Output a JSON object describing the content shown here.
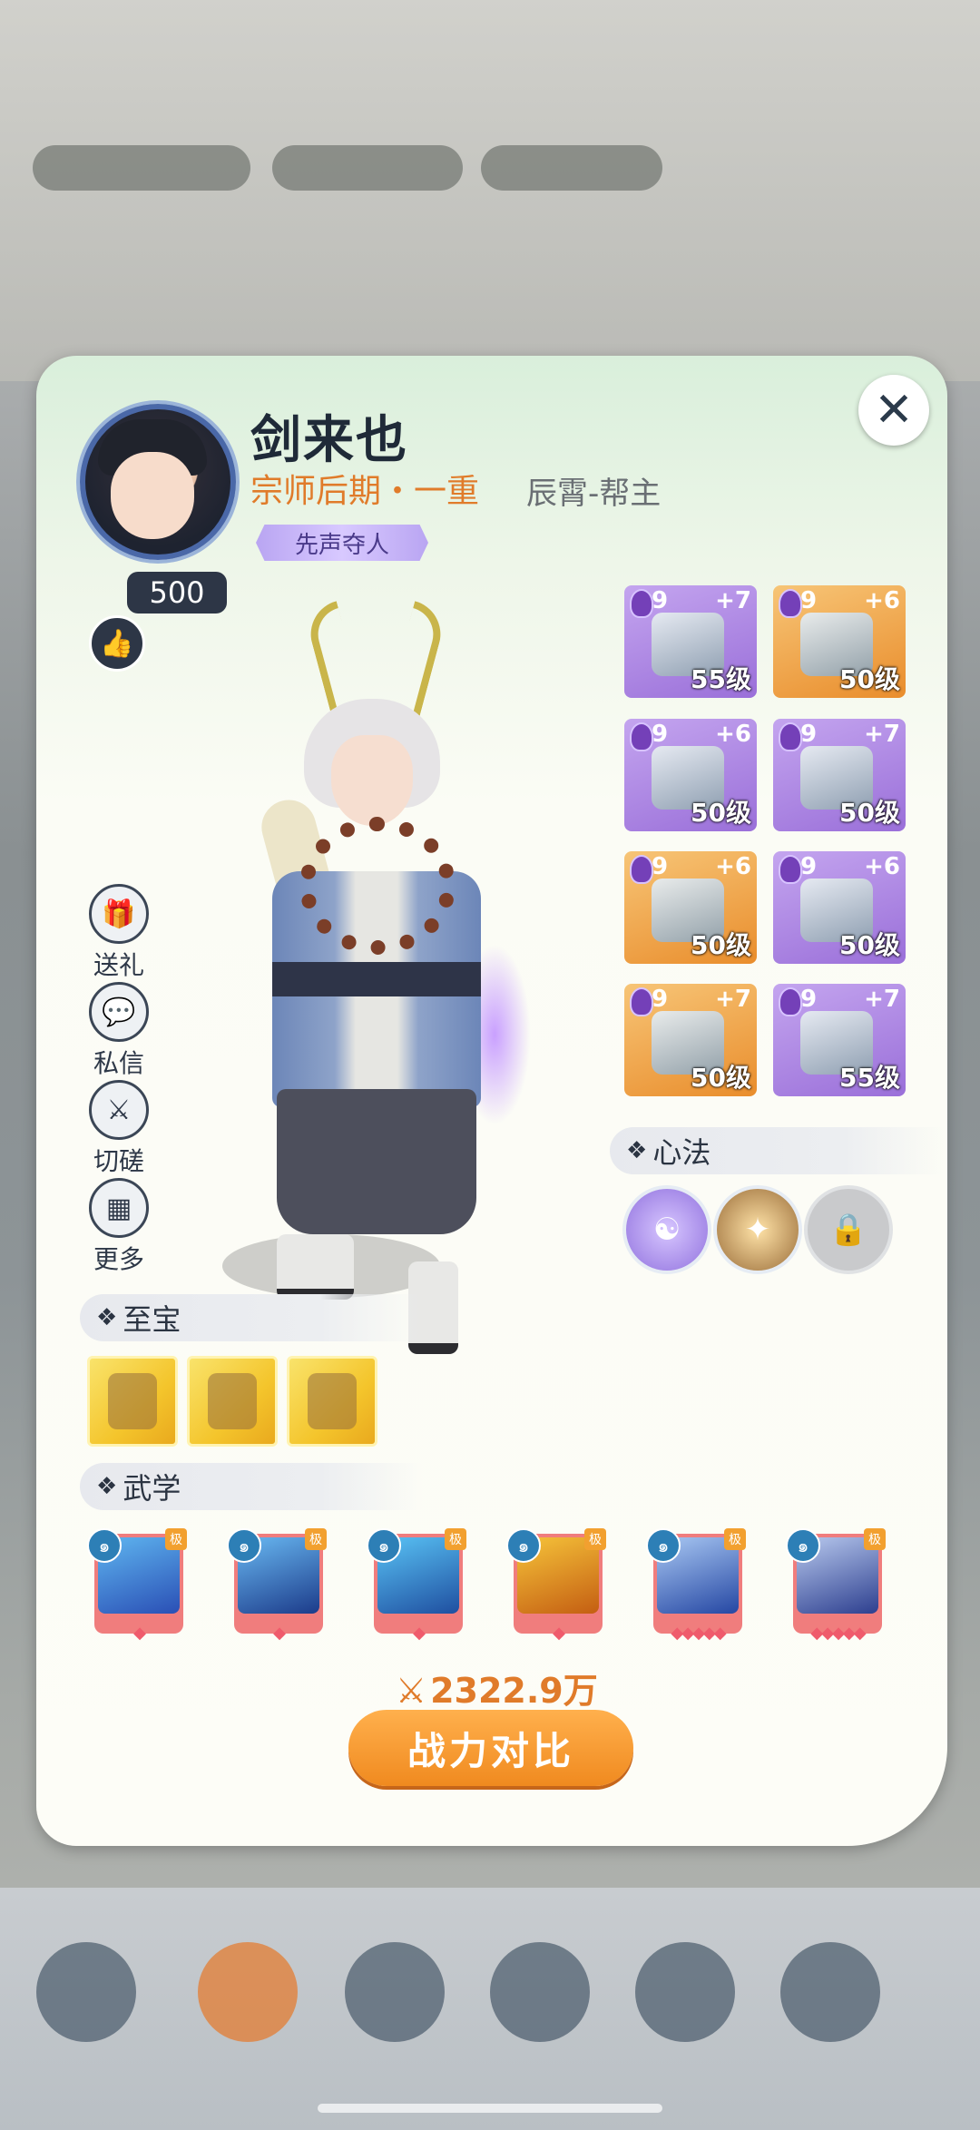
{
  "profile": {
    "name": "剑来也",
    "rank": "宗师后期・一重",
    "guild": "辰霄-帮主",
    "title_tag": "先声夺人",
    "likes": "500"
  },
  "actions": [
    {
      "label": "送礼",
      "icon": "gift-icon"
    },
    {
      "label": "私信",
      "icon": "message-icon"
    },
    {
      "label": "切磋",
      "icon": "crossed-swords-icon"
    },
    {
      "label": "更多",
      "icon": "more-grid-icon"
    }
  ],
  "equipment": [
    {
      "gem": "9",
      "plus": "+7",
      "level": "55级",
      "rarity": "purple",
      "icon": "sword-icon"
    },
    {
      "gem": "9",
      "plus": "+6",
      "level": "50级",
      "rarity": "orange",
      "icon": "helmet-icon"
    },
    {
      "gem": "9",
      "plus": "+6",
      "level": "50级",
      "rarity": "purple",
      "icon": "robe-icon"
    },
    {
      "gem": "9",
      "plus": "+7",
      "level": "50级",
      "rarity": "purple",
      "icon": "leg-armor-icon"
    },
    {
      "gem": "9",
      "plus": "+6",
      "level": "50级",
      "rarity": "orange",
      "icon": "bracer-icon"
    },
    {
      "gem": "9",
      "plus": "+6",
      "level": "50级",
      "rarity": "purple",
      "icon": "boots-icon"
    },
    {
      "gem": "9",
      "plus": "+7",
      "level": "50级",
      "rarity": "orange",
      "icon": "ring-icon"
    },
    {
      "gem": "9",
      "plus": "+7",
      "level": "55级",
      "rarity": "purple",
      "icon": "pendant-icon"
    }
  ],
  "sections": {
    "xinfa": "心法",
    "zhibao": "至宝",
    "wuxue": "武学"
  },
  "xinfa_slots": [
    {
      "icon": "meditation-icon",
      "state": "equipped"
    },
    {
      "icon": "martial-artist-icon",
      "state": "equipped"
    },
    {
      "icon": "lock-icon",
      "state": "locked"
    }
  ],
  "treasures": [
    {
      "icon": "pagoda-icon"
    },
    {
      "icon": "crystal-icon"
    },
    {
      "icon": "bonsai-icon"
    }
  ],
  "skills": [
    {
      "icon": "ice-cubes-icon",
      "grade": "极",
      "dots": "◆",
      "colors": [
        "#2a4fb5",
        "#5fb6f0"
      ]
    },
    {
      "icon": "lightning-icon",
      "grade": "极",
      "dots": "◆",
      "colors": [
        "#1c3b8a",
        "#69b9f2"
      ]
    },
    {
      "icon": "frost-star-icon",
      "grade": "极",
      "dots": "◆",
      "colors": [
        "#1f4fa0",
        "#59c3f5"
      ]
    },
    {
      "icon": "golden-dragon-icon",
      "grade": "极",
      "dots": "◆",
      "colors": [
        "#c45e12",
        "#f6c43a"
      ]
    },
    {
      "icon": "palm-strike-icon",
      "grade": "极",
      "dots": "◆◆◆◆◆",
      "colors": [
        "#2547a3",
        "#a9c8f3"
      ]
    },
    {
      "icon": "claw-icon",
      "grade": "极",
      "dots": "◆◆◆◆◆",
      "colors": [
        "#2d3f8f",
        "#b8c9ee"
      ]
    }
  ],
  "power": "2322.9万",
  "compare_button": "战力对比",
  "close_icon": "close-icon"
}
